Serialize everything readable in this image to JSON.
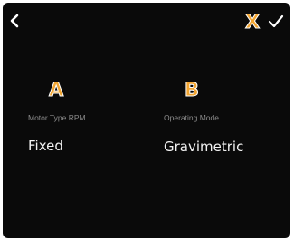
{
  "header": {
    "back_icon": "chevron-left-icon",
    "confirm_icon": "check-icon",
    "annotation_x": "X"
  },
  "fields": {
    "motor_type_rpm": {
      "marker": "A",
      "label": "Motor Type RPM",
      "value": "Fixed"
    },
    "operating_mode": {
      "marker": "B",
      "label": "Operating Mode",
      "value": "Gravimetric"
    }
  },
  "colors": {
    "background": "#0a0a0a",
    "label": "#8c8c8c",
    "value": "#f2f2f2",
    "annotation": "#f2a531"
  }
}
